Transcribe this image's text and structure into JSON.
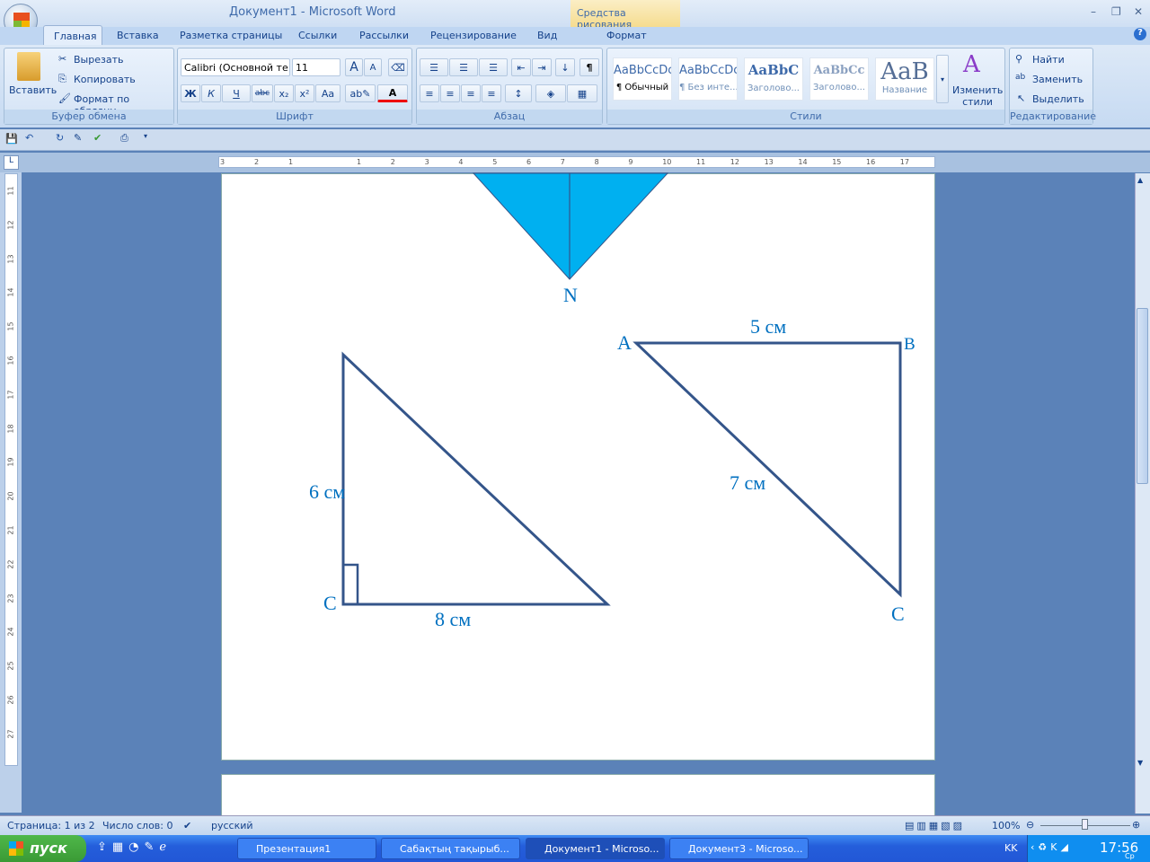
{
  "window": {
    "title": "Документ1 - Microsoft Word",
    "context_tab": "Средства рисования",
    "minimize": "–",
    "restore": "❐",
    "close": "✕",
    "help": "?"
  },
  "tabs": [
    "Главная",
    "Вставка",
    "Разметка страницы",
    "Ссылки",
    "Рассылки",
    "Рецензирование",
    "Вид",
    "Формат"
  ],
  "clipboard": {
    "paste": "Вставить",
    "cut": "Вырезать",
    "copy": "Копировать",
    "format_painter": "Формат по образцу",
    "label": "Буфер обмена"
  },
  "font": {
    "name": "Calibri (Основной те",
    "size": "11",
    "bold": "Ж",
    "italic": "К",
    "underline": "Ч",
    "strike": "abc",
    "sub": "x₂",
    "sup": "x²",
    "case": "Aa",
    "grow": "A",
    "shrink": "A",
    "color": "A",
    "label": "Шрифт"
  },
  "paragraph": {
    "label": "Абзац",
    "pilcrow": "¶"
  },
  "styles": {
    "items": [
      {
        "preview": "AaBbCcDc",
        "name": "¶ Обычный"
      },
      {
        "preview": "AaBbCcDc",
        "name": "¶ Без инте..."
      },
      {
        "preview": "AaBbC",
        "name": "Заголово..."
      },
      {
        "preview": "AaBbCc",
        "name": "Заголово..."
      },
      {
        "preview": "AaB",
        "name": "Название"
      }
    ],
    "change": "Изменить стили",
    "label": "Стили"
  },
  "editing": {
    "find": "Найти",
    "replace": "Заменить",
    "select": "Выделить",
    "label": "Редактирование"
  },
  "ruler": {
    "h": [
      "3",
      "2",
      "1",
      "1",
      "2",
      "3",
      "4",
      "5",
      "6",
      "7",
      "8",
      "9",
      "10",
      "11",
      "12",
      "13",
      "14",
      "15",
      "16",
      "17"
    ],
    "v": [
      "11",
      "12",
      "13",
      "14",
      "15",
      "16",
      "17",
      "18",
      "19",
      "20",
      "21",
      "22",
      "23",
      "24",
      "25",
      "26",
      "27"
    ]
  },
  "drawing": {
    "top_label": "N",
    "left": {
      "side_a": "6 см",
      "vertex_c": "C",
      "side_b": "8 см"
    },
    "right": {
      "a": "A",
      "b": "B",
      "c": "C",
      "ab": "5 см",
      "ac": "7 см"
    },
    "line_color": "#34558a",
    "label_color": "#0070c0",
    "fill_color": "#00b0f0"
  },
  "status": {
    "page": "Страница: 1 из 2",
    "words": "Число слов: 0",
    "lang": "русский",
    "zoom": "100%"
  },
  "taskbar": {
    "start": "пуск",
    "tasks": [
      "Презентация1",
      "Сабақтың тақырыб...",
      "Документ1 - Microso...",
      "Документ3 - Microso..."
    ],
    "lang": "KK",
    "time": "17:56",
    "day": "Ср"
  }
}
